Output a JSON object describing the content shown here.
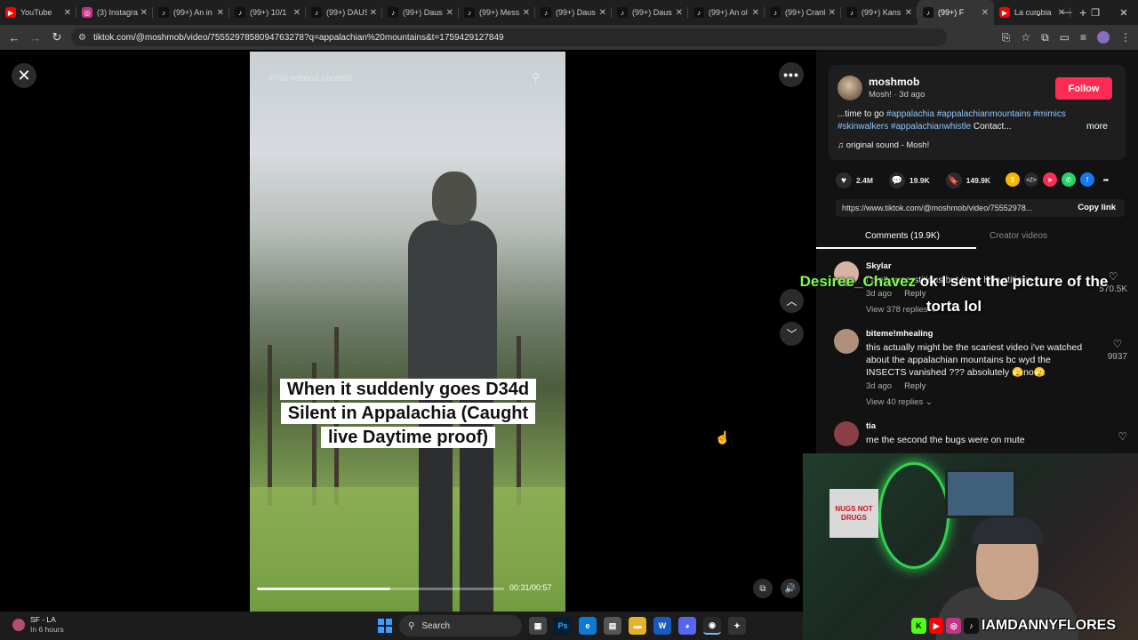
{
  "browser": {
    "tabs": [
      {
        "label": "YouTube",
        "icon": "youtube-icon",
        "color": "#ff0000",
        "glyph": "▶"
      },
      {
        "label": "(3) Instagram",
        "icon": "instagram-icon",
        "color": "#c13584",
        "glyph": "◎"
      },
      {
        "label": "(99+) An in",
        "icon": "tiktok-icon",
        "color": "#111111",
        "glyph": "♪"
      },
      {
        "label": "(99+) 10/1",
        "icon": "tiktok-icon",
        "color": "#111111",
        "glyph": "♪"
      },
      {
        "label": "(99+) DAUS",
        "icon": "tiktok-icon",
        "color": "#111111",
        "glyph": "♪"
      },
      {
        "label": "(99+) Daus",
        "icon": "tiktok-icon",
        "color": "#111111",
        "glyph": "♪"
      },
      {
        "label": "(99+) Mess",
        "icon": "tiktok-icon",
        "color": "#111111",
        "glyph": "♪"
      },
      {
        "label": "(99+) Daus",
        "icon": "tiktok-icon",
        "color": "#111111",
        "glyph": "♪"
      },
      {
        "label": "(99+) Daus",
        "icon": "tiktok-icon",
        "color": "#111111",
        "glyph": "♪"
      },
      {
        "label": "(99+) An ol",
        "icon": "tiktok-icon",
        "color": "#111111",
        "glyph": "♪"
      },
      {
        "label": "(99+) Cranl",
        "icon": "tiktok-icon",
        "color": "#111111",
        "glyph": "♪"
      },
      {
        "label": "(99+) Kans",
        "icon": "tiktok-icon",
        "color": "#111111",
        "glyph": "♪"
      },
      {
        "label": "(99+) F",
        "icon": "tiktok-icon",
        "color": "#111111",
        "glyph": "♪",
        "active": true
      },
      {
        "label": "La cumbia",
        "icon": "youtube-icon",
        "color": "#ff0000",
        "glyph": "▶"
      }
    ],
    "url": "tiktok.com/@moshmob/video/7555297858094763278?q=appalachian%20mountains&t=1759429127849"
  },
  "video": {
    "search_placeholder": "Find related content",
    "caption": "When it suddenly goes D34d Silent in Appalachia (Caught live Daytime proof)",
    "timecode": "00:31/00:57",
    "progress": 0.54
  },
  "post": {
    "author": "moshmob",
    "meta": "Mosh! · 3d ago",
    "follow_label": "Follow",
    "desc_prefix": "...time to go ",
    "tags_line1": "#appalachia #appalachianmountains #mimics",
    "tags_line2": "#skinwalkers #appalachianwhistle",
    "desc_suffix": " Contact...",
    "more_label": "more",
    "sound": "original sound - Mosh!",
    "likes": "2.4M",
    "comments": "19.9K",
    "saves": "149.9K",
    "link": "https://www.tiktok.com/@moshmob/video/75552978...",
    "copy_label": "Copy link"
  },
  "tabs": {
    "comments": "Comments (19.9K)",
    "creator": "Creator videos"
  },
  "comments": [
    {
      "user": "Skylar",
      "text": "I ain't superstitious but I'm a little stitious",
      "time": "3d ago",
      "reply": "Reply",
      "replies": "View 378 replies",
      "likes": "570.5K",
      "avatar": "#d7b3a5"
    },
    {
      "user": "biteme!mhealing",
      "text": "this actually might be the scariest video i've watched about the appalachian mountains bc wyd the INSECTS vanished ??? absolutely 🫣no🫣",
      "time": "3d ago",
      "reply": "Reply",
      "replies": "View 40 replies",
      "likes": "9937",
      "avatar": "#b08f7a"
    },
    {
      "user": "tia",
      "text": "me the second the bugs were on mute",
      "time": "",
      "reply": "",
      "replies": "",
      "likes": "",
      "avatar": "#8a3f46"
    }
  ],
  "stream": {
    "chat_name": "Desiree_Chavez",
    "chat_message": "ok I sent the picture of the torta lol",
    "handle": "IAMDANNYFLORES",
    "sign_text": "NUGS NOT DRUGS"
  },
  "taskbar": {
    "weather_title": "SF - LA",
    "weather_sub": "In 6 hours",
    "search_label": "Search"
  },
  "colors": {
    "follow": "#fe2c55",
    "hashtag": "#8ec5ff",
    "chat_name": "#7dff4a"
  }
}
